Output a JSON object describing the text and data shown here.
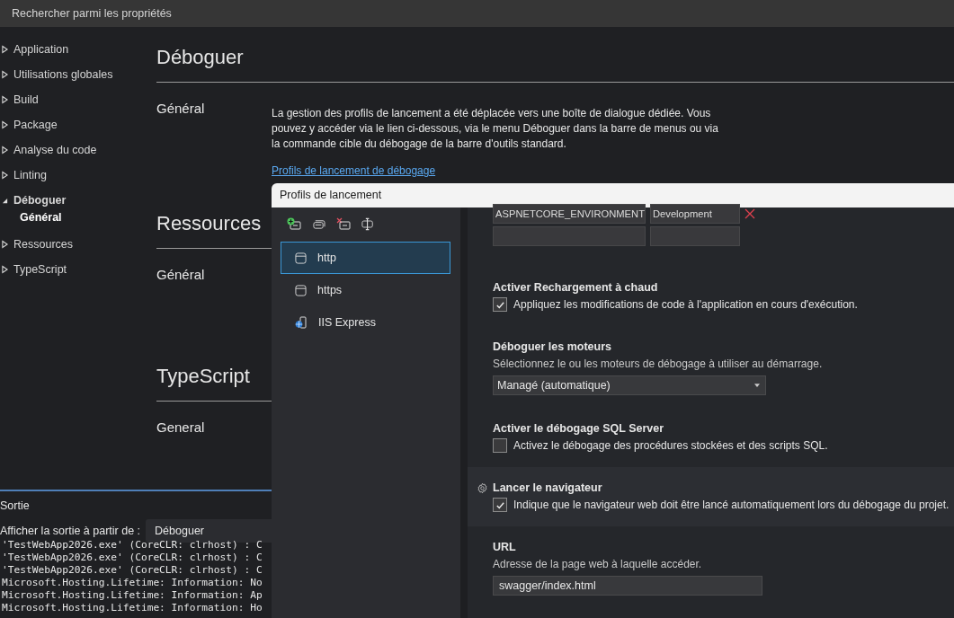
{
  "search": {
    "placeholder": "Rechercher parmi les propriétés"
  },
  "sidebar": {
    "items": [
      {
        "label": "Application",
        "expanded": false,
        "selected": false
      },
      {
        "label": "Utilisations globales",
        "expanded": false,
        "selected": false
      },
      {
        "label": "Build",
        "expanded": false,
        "selected": false
      },
      {
        "label": "Package",
        "expanded": false,
        "selected": false
      },
      {
        "label": "Analyse du code",
        "expanded": false,
        "selected": false
      },
      {
        "label": "Linting",
        "expanded": false,
        "selected": false
      },
      {
        "label": "Déboguer",
        "expanded": true,
        "selected": false,
        "children": [
          {
            "label": "Général",
            "selected": true
          }
        ]
      },
      {
        "label": "Ressources",
        "expanded": false,
        "selected": false
      },
      {
        "label": "TypeScript",
        "expanded": false,
        "selected": false
      }
    ]
  },
  "sections": [
    {
      "title": "Déboguer",
      "groups": [
        {
          "label": "Général",
          "description": "La gestion des profils de lancement a été déplacée vers une boîte de dialogue dédiée. Vous pouvez y accéder via le lien ci-dessous, via le menu Déboguer dans la barre de menus ou via la commande cible du débogage de la barre d'outils standard.",
          "link": "Profils de lancement de débogage"
        }
      ]
    },
    {
      "title": "Ressources",
      "groups": [
        {
          "label": "Général"
        }
      ]
    },
    {
      "title": "TypeScript",
      "groups": [
        {
          "label": "General"
        }
      ]
    }
  ],
  "output": {
    "title": "Sortie",
    "source_label": "Afficher la sortie à partir de :",
    "source": "Déboguer",
    "lines": [
      "'TestWebApp2026.exe' (CoreCLR: clrhost) : C",
      "'TestWebApp2026.exe' (CoreCLR: clrhost) : C",
      "'TestWebApp2026.exe' (CoreCLR: clrhost) : C",
      "Microsoft.Hosting.Lifetime: Information: No",
      "Microsoft.Hosting.Lifetime: Information: Ap",
      "Microsoft.Hosting.Lifetime: Information: Ho"
    ]
  },
  "dialog": {
    "title": "Profils de lancement",
    "profiles": [
      {
        "name": "http",
        "kind": "project",
        "selected": true
      },
      {
        "name": "https",
        "kind": "project",
        "selected": false
      },
      {
        "name": "IIS Express",
        "kind": "iis",
        "selected": false
      }
    ],
    "environment_variables": [
      {
        "name": "ASPNETCORE_ENVIRONMENT",
        "value": "Development"
      }
    ],
    "settings": [
      {
        "kind": "checkbox",
        "title": "Activer Rechargement à chaud",
        "label": "Appliquez les modifications de code à l'application en cours d'exécution.",
        "checked": true,
        "highlighted": false
      },
      {
        "kind": "select",
        "title": "Déboguer les moteurs",
        "description": "Sélectionnez le ou les moteurs de débogage à utiliser au démarrage.",
        "value": "Managé (automatique)",
        "highlighted": false
      },
      {
        "kind": "checkbox",
        "title": "Activer le débogage SQL Server",
        "label": "Activez le débogage des procédures stockées et des scripts SQL.",
        "checked": false,
        "highlighted": false
      },
      {
        "kind": "checkbox",
        "title": "Lancer le navigateur",
        "label": "Indique que le navigateur web doit être lancé automatiquement lors du débogage du projet.",
        "checked": true,
        "highlighted": true
      },
      {
        "kind": "text",
        "title": "URL",
        "description": "Adresse de la page web à laquelle accéder.",
        "value": "swagger/index.html",
        "highlighted": false
      }
    ]
  }
}
